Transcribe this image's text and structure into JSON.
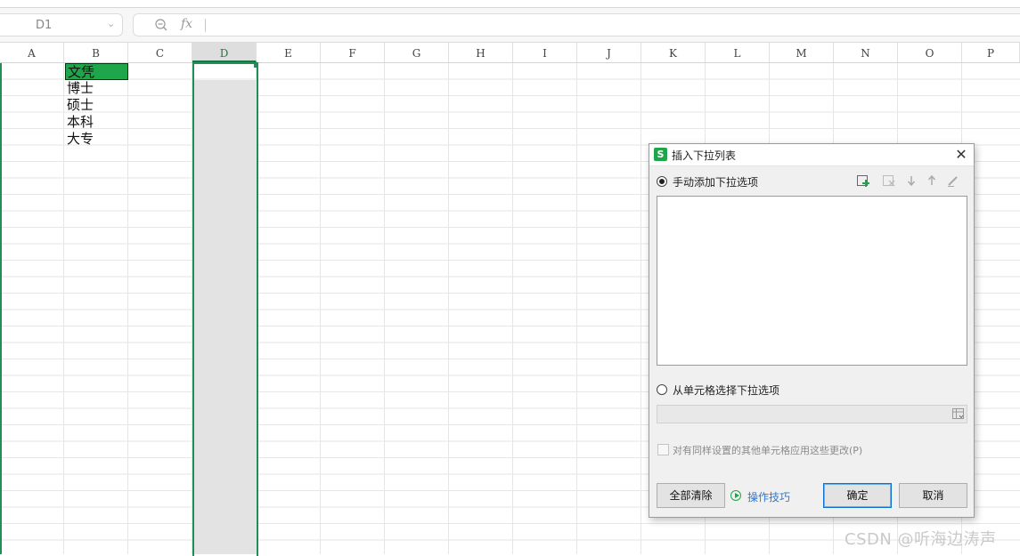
{
  "formula_bar": {
    "name_box": "D1",
    "fx_label": "fx"
  },
  "columns": [
    "A",
    "B",
    "C",
    "D",
    "E",
    "F",
    "G",
    "H",
    "I",
    "J",
    "K",
    "L",
    "M",
    "N",
    "O",
    "P"
  ],
  "selected_column": "D",
  "cells_b": [
    "文凭",
    "博士",
    "硕士",
    "本科",
    "大专"
  ],
  "dialog": {
    "title": "插入下拉列表",
    "app_icon": "S",
    "close": "✕",
    "manual_option": "手动添加下拉选项",
    "cell_option": "从单元格选择下拉选项",
    "apply_all": "对有同样设置的其他单元格应用这些更改(P)",
    "clear_all": "全部清除",
    "tips": "操作技巧",
    "ok": "确定",
    "cancel": "取消",
    "toolbar_icons": [
      "add-item-icon",
      "delete-item-icon",
      "move-down-icon",
      "move-up-icon",
      "edit-icon"
    ]
  },
  "colors": {
    "accent_green": "#1f8f5a",
    "header_cell_green": "#1fa64a",
    "link_blue": "#2b78d6"
  },
  "watermark": "CSDN @听海边涛声"
}
